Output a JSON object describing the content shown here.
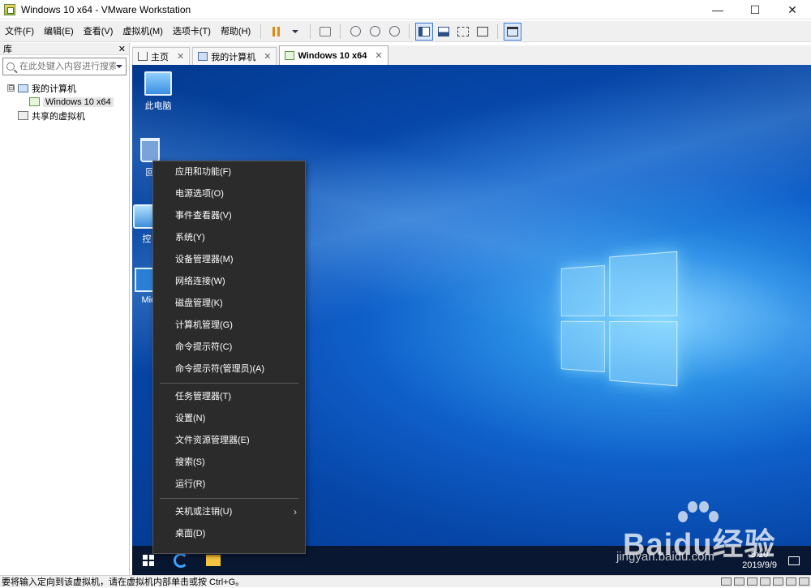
{
  "window": {
    "title": "Windows 10 x64 - VMware Workstation",
    "minimize": "—",
    "maximize": "☐",
    "close": "✕"
  },
  "menubar": {
    "items": [
      "文件(F)",
      "编辑(E)",
      "查看(V)",
      "虚拟机(M)",
      "选项卡(T)",
      "帮助(H)"
    ]
  },
  "library": {
    "title": "库",
    "close": "✕",
    "search_placeholder": "在此处键入内容进行搜索",
    "tree": {
      "my_computer": "我的计算机",
      "vm_name": "Windows 10 x64",
      "shared": "共享的虚拟机",
      "toggle": "⊟"
    }
  },
  "tabs": [
    {
      "label": "主页",
      "close": "✕"
    },
    {
      "label": "我的计算机",
      "close": "✕"
    },
    {
      "label": "Windows 10 x64",
      "close": "✕"
    }
  ],
  "desktop": {
    "icons": [
      "此电脑",
      "回",
      "控",
      "Mic"
    ]
  },
  "context_menu": {
    "items_group1": [
      "应用和功能(F)",
      "电源选项(O)",
      "事件查看器(V)",
      "系统(Y)",
      "设备管理器(M)",
      "网络连接(W)",
      "磁盘管理(K)",
      "计算机管理(G)",
      "命令提示符(C)",
      "命令提示符(管理员)(A)"
    ],
    "items_group2": [
      "任务管理器(T)",
      "设置(N)",
      "文件资源管理器(E)",
      "搜索(S)",
      "运行(R)"
    ],
    "items_group3": [
      "关机或注销(U)",
      "桌面(D)"
    ],
    "submenu_arrow": "›"
  },
  "taskbar": {
    "time": "8:10",
    "date": "2019/9/9"
  },
  "statusbar": {
    "text": "要将输入定向到该虚拟机，请在虚拟机内部单击或按 Ctrl+G。"
  },
  "watermark": {
    "logo": "Baidu经验",
    "url": "jingyan.baidu.com"
  }
}
